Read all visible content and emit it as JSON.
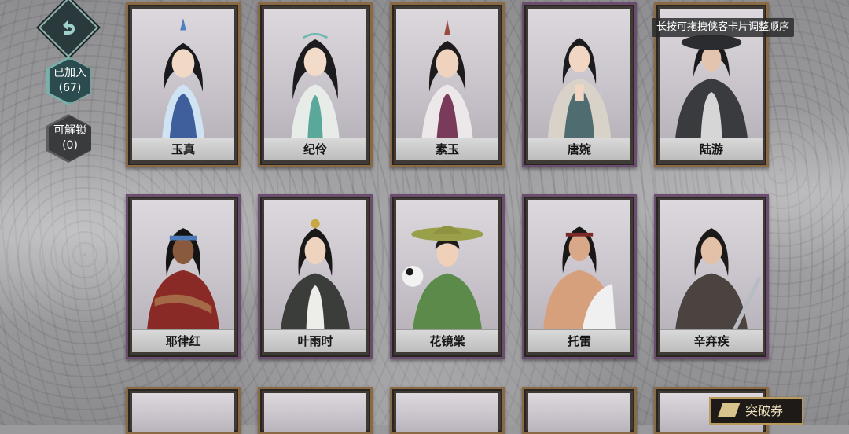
{
  "hint": "长按可拖拽侠客卡片调整顺序",
  "tabs": [
    {
      "label": "已加入",
      "count": "(67)"
    },
    {
      "label": "可解锁",
      "count": "(0)"
    }
  ],
  "cards": [
    {
      "name": "玉真"
    },
    {
      "name": "纪伶"
    },
    {
      "name": "素玉"
    },
    {
      "name": "唐婉"
    },
    {
      "name": "陆游"
    },
    {
      "name": "耶律红"
    },
    {
      "name": "叶雨时"
    },
    {
      "name": "花镜棠"
    },
    {
      "name": "托雷"
    },
    {
      "name": "辛弃疾"
    }
  ],
  "ticket": {
    "label": "突破券"
  },
  "colors": {
    "card_gold": "#8a6a44",
    "card_purple": "#6b4d70",
    "nav_teal": "#2c4b4e"
  }
}
